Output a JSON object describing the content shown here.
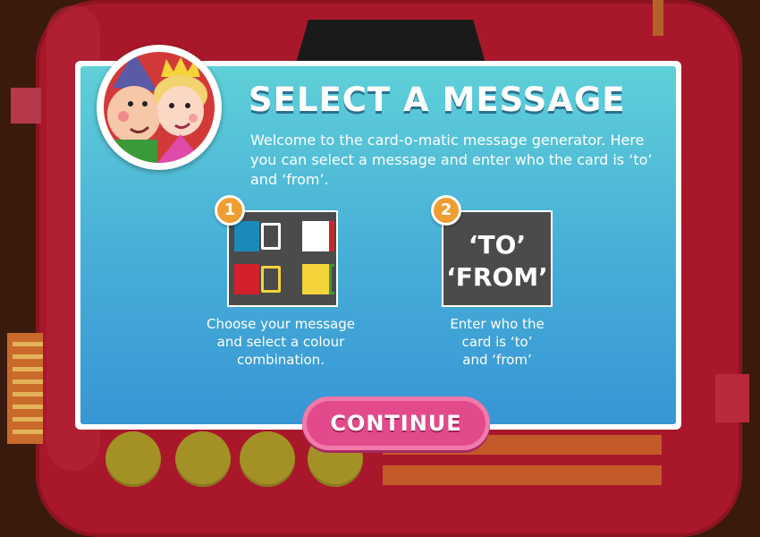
{
  "screen": {
    "title": "SELECT A MESSAGE",
    "intro": "Welcome to the card-o-matic message generator. Here you can select a message and enter who the card is ‘to’ and ‘from’."
  },
  "steps": [
    {
      "number": "1",
      "caption_line1": "Choose your message",
      "caption_line2": "and select a colour",
      "caption_line3": "combination.",
      "swatches": [
        {
          "fill": "#1a8bb8",
          "outline": "#ffffff"
        },
        {
          "fill": "#ffffff",
          "outline": "#d3202a"
        },
        {
          "fill": "#d3202a",
          "outline": "#f5d33a"
        },
        {
          "fill": "#f5d33a",
          "outline": "#3a9a3a"
        }
      ]
    },
    {
      "number": "2",
      "to_text": "‘TO’",
      "from_text": "‘FROM’",
      "caption_line1": "Enter who the",
      "caption_line2": "card is ‘to’",
      "caption_line3": "and ‘from’"
    }
  ],
  "buttons": {
    "continue": "CONTINUE"
  },
  "colors": {
    "machine": "#a8182a",
    "screen_top": "#5fd0d8",
    "screen_bottom": "#3796d4",
    "badge": "#f09d32",
    "button": "#e34a8c",
    "knob": "#a49126"
  }
}
